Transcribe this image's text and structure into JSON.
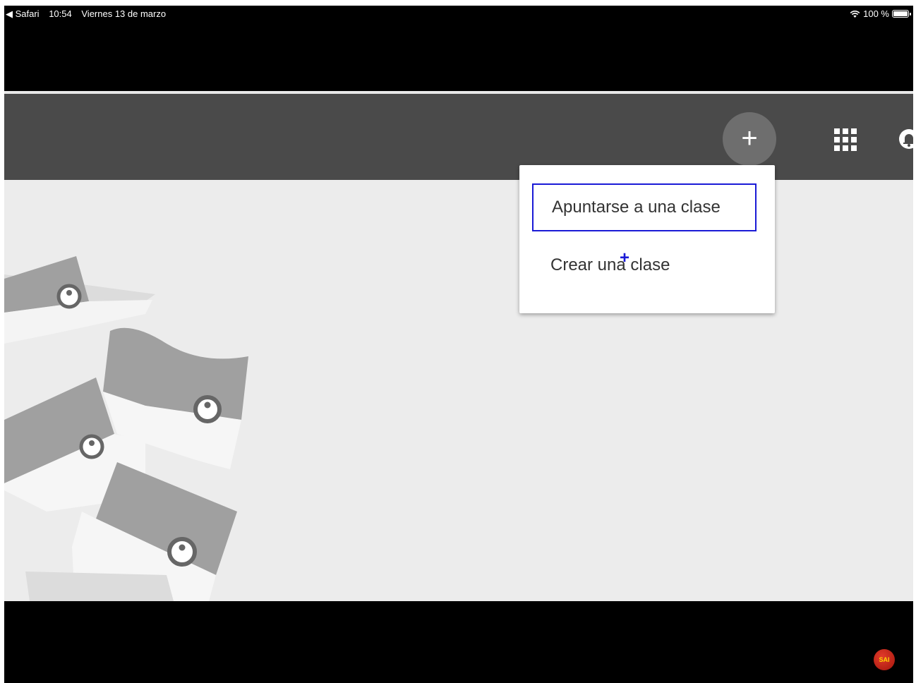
{
  "status_bar": {
    "back_app": "◀ Safari",
    "time": "10:54",
    "date": "Viernes 13 de marzo",
    "battery": "100 %"
  },
  "header": {
    "add_button_label": "+"
  },
  "menu": {
    "items": [
      {
        "label": "Apuntarse a una clase"
      },
      {
        "label": "Crear una clase"
      }
    ]
  },
  "watermark": {
    "text": "SAI"
  },
  "colors": {
    "header_bg": "#4a4a4a",
    "content_bg": "#ececec",
    "focus_outline": "#1a1ad6"
  }
}
